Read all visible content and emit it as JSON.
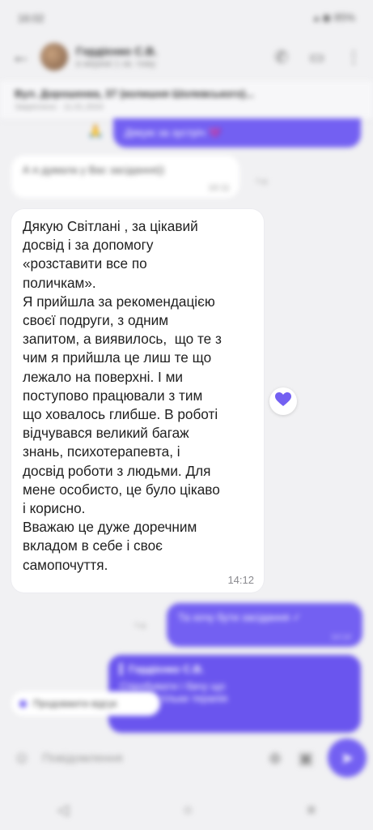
{
  "statusbar": {
    "time": "16:02",
    "right": "▴ ◉ 85%"
  },
  "header": {
    "back_icon": "←",
    "contact_name": "Гордієнко С.В.",
    "contact_status": "в мережі 1 хв. тому",
    "call_icon": "✆",
    "video_icon": "▭",
    "menu_icon": "⋮"
  },
  "pinned": {
    "title": "Вул. Дорошенка, 37 (колишня Шолевського)...",
    "subtitle": "Закріплено · 11.01.2024"
  },
  "messages": {
    "top_out_text": "Дякую за зустріч 💜",
    "top_emoji": "🙏",
    "in_blur_text": "А я думала у Вас засідання))",
    "in_blur_time": "16:11",
    "main_text": "Дякую Світлані , за цікавий\nдосвід і за допомогу\n«розставити все по\nполичкам».\nЯ прийшла за рекомендацією\nсвоєї подруги, з одним\nзапитом, а виявилось,  що те з\nчим я прийшла це лиш те що\nлежало на поверхні. І ми\nпоступово працювали з тим\nщо ховалось глибше. В роботі\nвідчувався великий багаж\nзнань, психотерапевта, і\nдосвід роботи з людьми. Для\nмене особисто, це було цікаво\nі корисно.\nВважаю це дуже доречним\nвкладом в себе і своє\nсамопочуття.",
    "main_time": "14:12",
    "reaction_icon": "heart-icon",
    "out2_text": "Та хочу бути засідання ✓",
    "out2_time": "14:14",
    "out3_name": "Гордієнко С.В.",
    "out3_line1": "Спробувати і бачу що",
    "out3_line2": "працює тільки терапія"
  },
  "chip": {
    "label": "Продовжити відгук"
  },
  "composer": {
    "placeholder": "Повідомлення",
    "emoji_icon": "☺",
    "attach_icon": "⊕",
    "sticker_icon": "▣",
    "send_icon": "➤"
  },
  "navbar": {
    "back": "◁",
    "home": "○",
    "recent": "≡"
  },
  "colors": {
    "accent": "#7360f2",
    "background": "#f1f1f3"
  }
}
